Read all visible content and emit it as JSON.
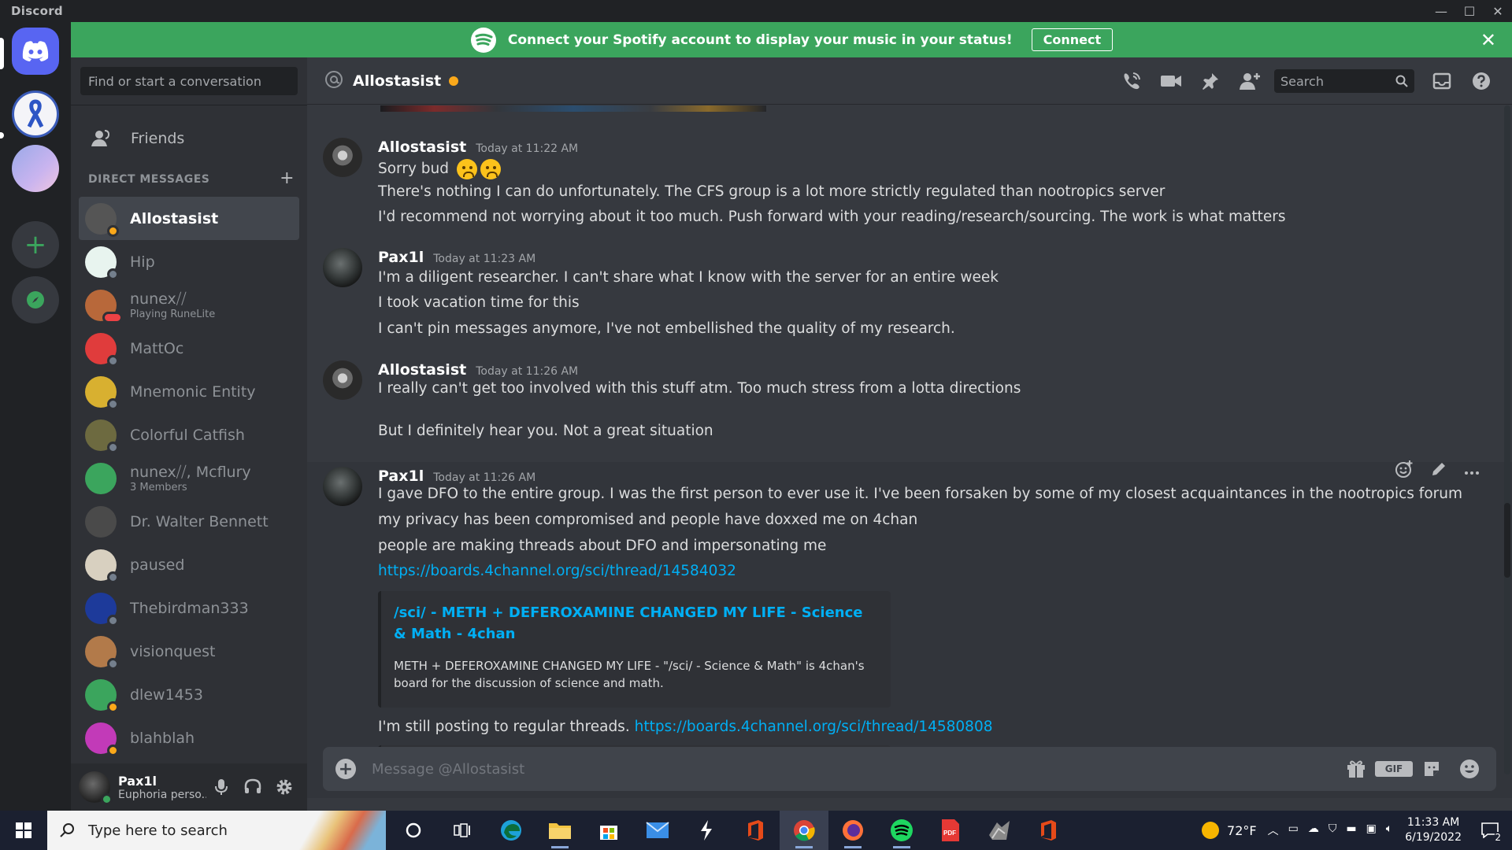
{
  "window": {
    "app_name": "Discord",
    "min": "—",
    "max": "☐",
    "close": "✕"
  },
  "banner": {
    "text": "Connect your Spotify account to display your music in your status!",
    "connect_label": "Connect",
    "close": "✕",
    "color": "#3ba55d"
  },
  "dm_panel": {
    "search_placeholder": "Find or start a conversation",
    "friends_label": "Friends",
    "header": "DIRECT MESSAGES",
    "add": "+",
    "items": [
      {
        "name": "Allostasist",
        "sub": "",
        "status": "idle",
        "active": true,
        "avatar_color": "#555"
      },
      {
        "name": "Hip",
        "sub": "",
        "status": "offline",
        "avatar_color": "#e8f4ef"
      },
      {
        "name": "nunex⧸⧸",
        "sub": "Playing RuneLite",
        "status": "dnd",
        "avatar_color": "#b8683a"
      },
      {
        "name": "MattOc",
        "sub": "",
        "status": "offline",
        "avatar_color": "#e03c3c"
      },
      {
        "name": "Mnemonic Entity",
        "sub": "",
        "status": "offline",
        "avatar_color": "#d8b030"
      },
      {
        "name": "Colorful Catfish",
        "sub": "",
        "status": "offline",
        "avatar_color": "#6d6a40"
      },
      {
        "name": "nunex⧸⧸, Mcflury",
        "sub": "3 Members",
        "status": "group",
        "avatar_color": "#3ba55d"
      },
      {
        "name": "Dr. Walter Bennett",
        "sub": "",
        "status": "none",
        "avatar_color": "#4a4a4a"
      },
      {
        "name": "paused",
        "sub": "",
        "status": "offline",
        "avatar_color": "#d8d0c0"
      },
      {
        "name": "Thebirdman333",
        "sub": "",
        "status": "offline",
        "avatar_color": "#1d3a9a"
      },
      {
        "name": "visionquest",
        "sub": "",
        "status": "offline",
        "avatar_color": "#b27a4a"
      },
      {
        "name": "dlew1453",
        "sub": "",
        "status": "idle",
        "avatar_color": "#3ba55d"
      },
      {
        "name": "blahblah",
        "sub": "",
        "status": "idle",
        "avatar_color": "#c23ab8"
      }
    ]
  },
  "user_bar": {
    "name": "Pax1l",
    "status_text": "Euphoria perso..."
  },
  "chat": {
    "channel": "Allostasist",
    "search_placeholder": "Search",
    "message_placeholder": "Message @Allostasist",
    "groups": [
      {
        "author": "Allostasist",
        "time": "Today at 11:22 AM",
        "avatar": "allo",
        "lines": [
          "Sorry bud",
          "There's nothing I can do unfortunately. The CFS group is a lot more strictly regulated than nootropics server",
          "I'd recommend not worrying about it too much. Push forward with your reading/research/sourcing. The work is what matters"
        ]
      },
      {
        "author": "Pax1l",
        "time": "Today at 11:23 AM",
        "avatar": "pax",
        "lines": [
          "I'm a diligent researcher. I can't share what I know with the server for an entire week",
          "I took vacation time for this",
          "I can't pin messages anymore, I've not embellished the quality of my research."
        ]
      },
      {
        "author": "Allostasist",
        "time": "Today at 11:26 AM",
        "avatar": "allo",
        "lines": [
          "I really can't get too involved with this stuff atm. Too much stress from a lotta directions",
          "But I definitely hear you. Not a great situation"
        ]
      },
      {
        "author": "Pax1l",
        "time": "Today at 11:26 AM",
        "avatar": "pax",
        "lines": [
          "I gave DFO to the entire group. I was the first person to ever use it. I've been forsaken by some of my closest acquaintances in the nootropics forum",
          "my privacy has been compromised and people have doxxed me on 4chan",
          "people are making threads about DFO and impersonating me"
        ],
        "link1": "https://boards.4channel.org/sci/thread/14584032",
        "embed_title": "/sci/ - METH + DEFEROXAMINE CHANGED MY LIFE - Science & Math - 4chan",
        "embed_desc": "METH + DEFEROXAMINE CHANGED MY LIFE - \"/sci/ - Science & Math\" is 4chan's board for the discussion of science and math.",
        "last_text": "I'm still posting to regular threads. ",
        "link2": "https://boards.4channel.org/sci/thread/14580808"
      }
    ]
  },
  "taskbar": {
    "search_placeholder": "Type here to search",
    "weather": "72°F",
    "time": "11:33 AM",
    "date": "6/19/2022",
    "notification_count": "2"
  }
}
